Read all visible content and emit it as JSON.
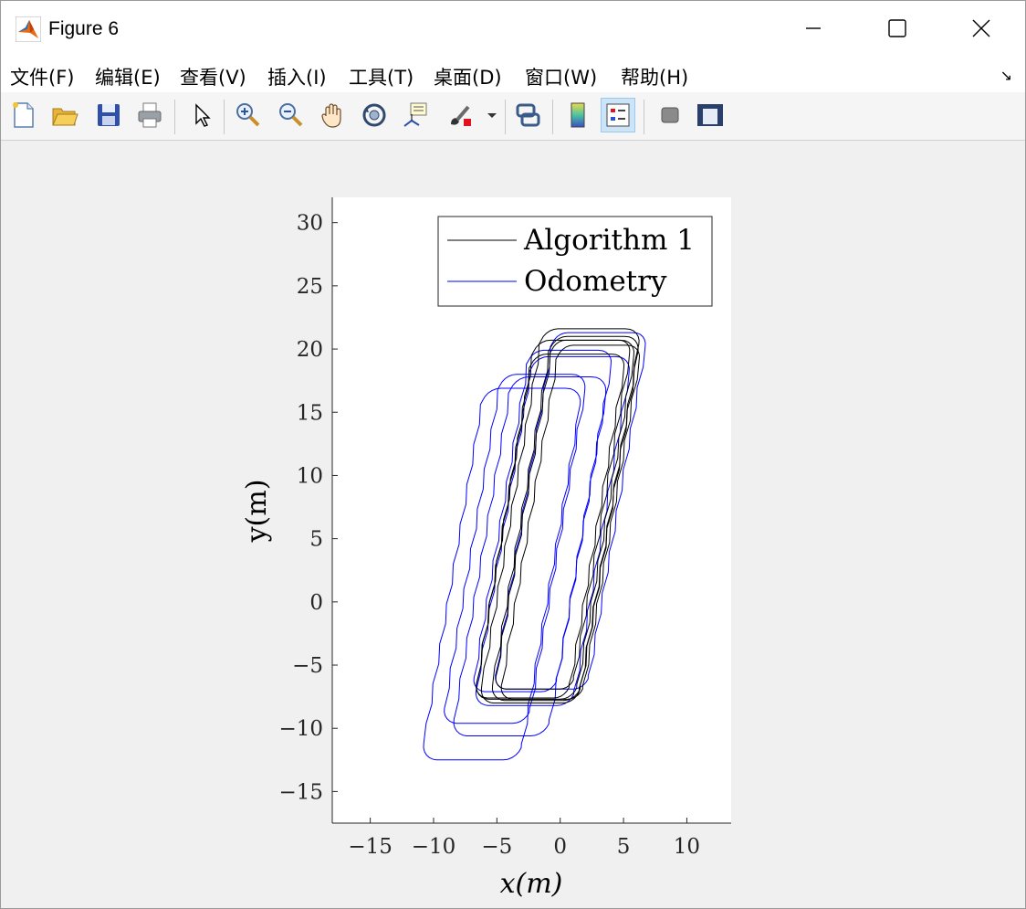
{
  "window": {
    "title": "Figure 6",
    "controls": {
      "minimize": "minimize",
      "maximize": "maximize",
      "close": "close"
    }
  },
  "menu": {
    "items": [
      {
        "label": "文件(F)",
        "key": "F"
      },
      {
        "label": "编辑(E)",
        "key": "E"
      },
      {
        "label": "查看(V)",
        "key": "V"
      },
      {
        "label": "插入(I)",
        "key": "I"
      },
      {
        "label": "工具(T)",
        "key": "T"
      },
      {
        "label": "桌面(D)",
        "key": "D"
      },
      {
        "label": "窗口(W)",
        "key": "W"
      },
      {
        "label": "帮助(H)",
        "key": "H"
      }
    ],
    "dock_arrow": "↘"
  },
  "toolbar": {
    "icons": [
      "new-figure-icon",
      "open-file-icon",
      "save-icon",
      "print-icon",
      "edit-plot-arrow-icon",
      "zoom-in-icon",
      "zoom-out-icon",
      "pan-hand-icon",
      "rotate-3d-icon",
      "data-cursor-icon",
      "brush-icon",
      "brush-dropdown-icon",
      "link-plot-icon",
      "colorbar-icon",
      "legend-icon",
      "hide-plot-tools-icon",
      "show-plot-tools-icon"
    ],
    "active": "legend-icon"
  },
  "chart_data": {
    "type": "line",
    "xlabel": "x(m)",
    "ylabel": "y(m)",
    "xlim": [
      -18,
      13.5
    ],
    "ylim": [
      -17.5,
      32
    ],
    "xticks": [
      -15,
      -10,
      -5,
      0,
      5,
      10
    ],
    "yticks": [
      -15,
      -10,
      -5,
      0,
      5,
      10,
      15,
      20,
      25,
      30
    ],
    "legend_position": "top-right",
    "series": [
      {
        "name": "Algorithm 1",
        "color": "#000000",
        "loops": [
          {
            "cx": 0.0,
            "cy": 6.8,
            "w": 7.8,
            "h": 29.6,
            "r": 1.2
          },
          {
            "cx": 0.4,
            "cy": 6.6,
            "w": 7.0,
            "h": 28.8,
            "r": 1.2
          },
          {
            "cx": 0.8,
            "cy": 6.3,
            "w": 6.5,
            "h": 28.0,
            "r": 1.1
          },
          {
            "cx": -0.4,
            "cy": 6.5,
            "w": 8.0,
            "h": 28.4,
            "r": 1.2
          },
          {
            "cx": 0.2,
            "cy": 6.9,
            "w": 6.2,
            "h": 27.6,
            "r": 1.0
          },
          {
            "cx": -0.8,
            "cy": 6.0,
            "w": 7.4,
            "h": 27.2,
            "r": 1.1
          }
        ]
      },
      {
        "name": "Odometry",
        "color": "#0000ff",
        "loops": [
          {
            "cx": 0.8,
            "cy": 7.2,
            "w": 7.4,
            "h": 28.2,
            "r": 1.1
          },
          {
            "cx": -0.6,
            "cy": 5.6,
            "w": 7.8,
            "h": 27.6,
            "r": 1.2
          },
          {
            "cx": -2.4,
            "cy": 3.6,
            "w": 7.6,
            "h": 28.4,
            "r": 1.3
          },
          {
            "cx": -4.6,
            "cy": 2.2,
            "w": 7.8,
            "h": 29.4,
            "r": 1.3
          },
          {
            "cx": -3.6,
            "cy": 4.2,
            "w": 6.8,
            "h": 27.6,
            "r": 1.2
          },
          {
            "cx": -1.4,
            "cy": 6.4,
            "w": 6.6,
            "h": 27.0,
            "r": 1.1
          }
        ]
      }
    ]
  }
}
